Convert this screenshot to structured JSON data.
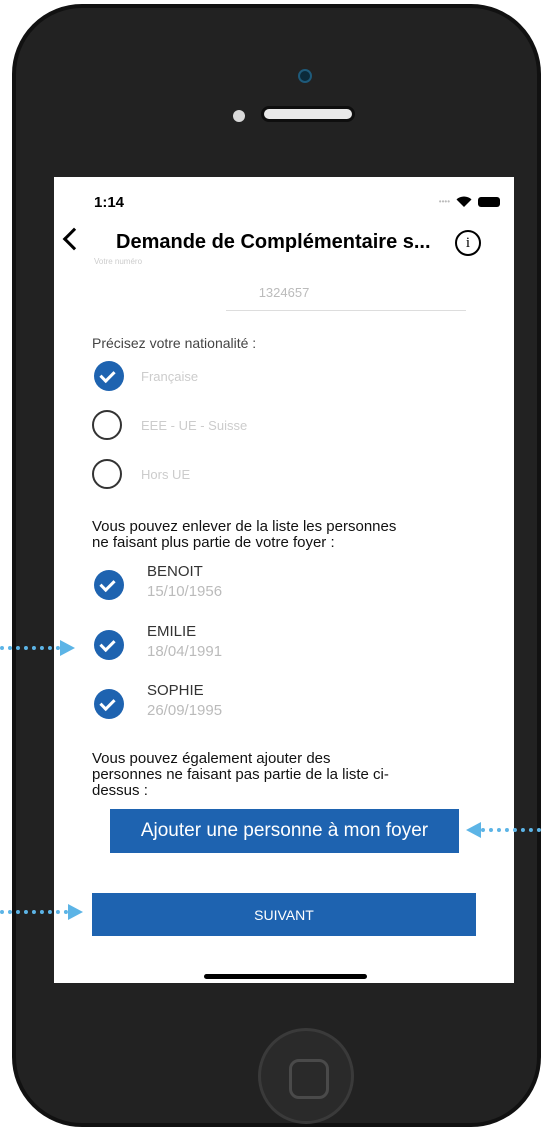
{
  "status": {
    "time": "1:14"
  },
  "nav": {
    "title": "Demande de Complémentaire s...",
    "info_symbol": "i",
    "faint_label": "Votre numéro"
  },
  "form": {
    "number_value": "1324657",
    "nationality_label": "Précisez votre nationalité :",
    "nationality_options": [
      {
        "label": "Française",
        "checked": true
      },
      {
        "label": "EEE - UE - Suisse",
        "checked": false
      },
      {
        "label": "Hors UE",
        "checked": false
      }
    ],
    "remove_label_line1": "Vous pouvez enlever de la liste les personnes",
    "remove_label_line2": "ne faisant plus partie de votre foyer :",
    "persons": [
      {
        "name": "BENOIT",
        "date": "15/10/1956",
        "checked": true
      },
      {
        "name": "EMILIE",
        "date": "18/04/1991",
        "checked": true
      },
      {
        "name": "SOPHIE",
        "date": "26/09/1995",
        "checked": true
      }
    ],
    "add_label_line1": "Vous pouvez également ajouter des",
    "add_label_line2": "personnes ne faisant pas partie de la liste ci-",
    "add_label_line3": "dessus :",
    "add_button": "Ajouter une personne à mon foyer",
    "next_button": "SUIVANT"
  },
  "colors": {
    "accent": "#1e63b0",
    "annotation": "#5cb4e6",
    "phone": "#222222"
  }
}
